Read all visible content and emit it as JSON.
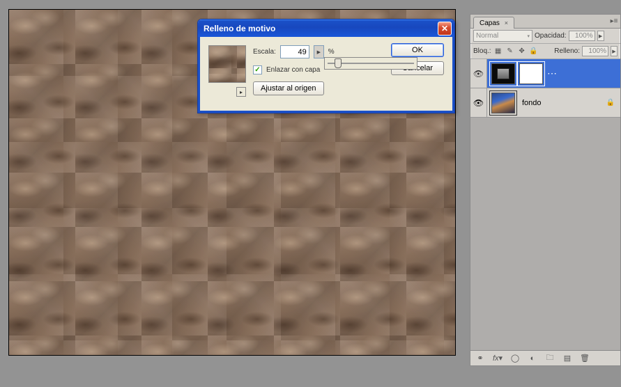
{
  "dialog": {
    "title": "Relleno de motivo",
    "scale_label": "Escala:",
    "scale_value": "49",
    "percent": "%",
    "link_label": "Enlazar con capa",
    "link_checked": true,
    "snap_label": "Ajustar al origen",
    "ok_label": "OK",
    "cancel_label": "Cancelar"
  },
  "panel": {
    "tab_label": "Capas",
    "blend_mode": "Normal",
    "opacity_label": "Opacidad:",
    "opacity_value": "100%",
    "lock_label": "Bloq.:",
    "fill_label": "Relleno:",
    "fill_value": "100%",
    "layers": [
      {
        "name": "",
        "type": "fill",
        "selected": true,
        "locked": false
      },
      {
        "name": "fondo",
        "type": "photo",
        "selected": false,
        "locked": true
      }
    ]
  }
}
